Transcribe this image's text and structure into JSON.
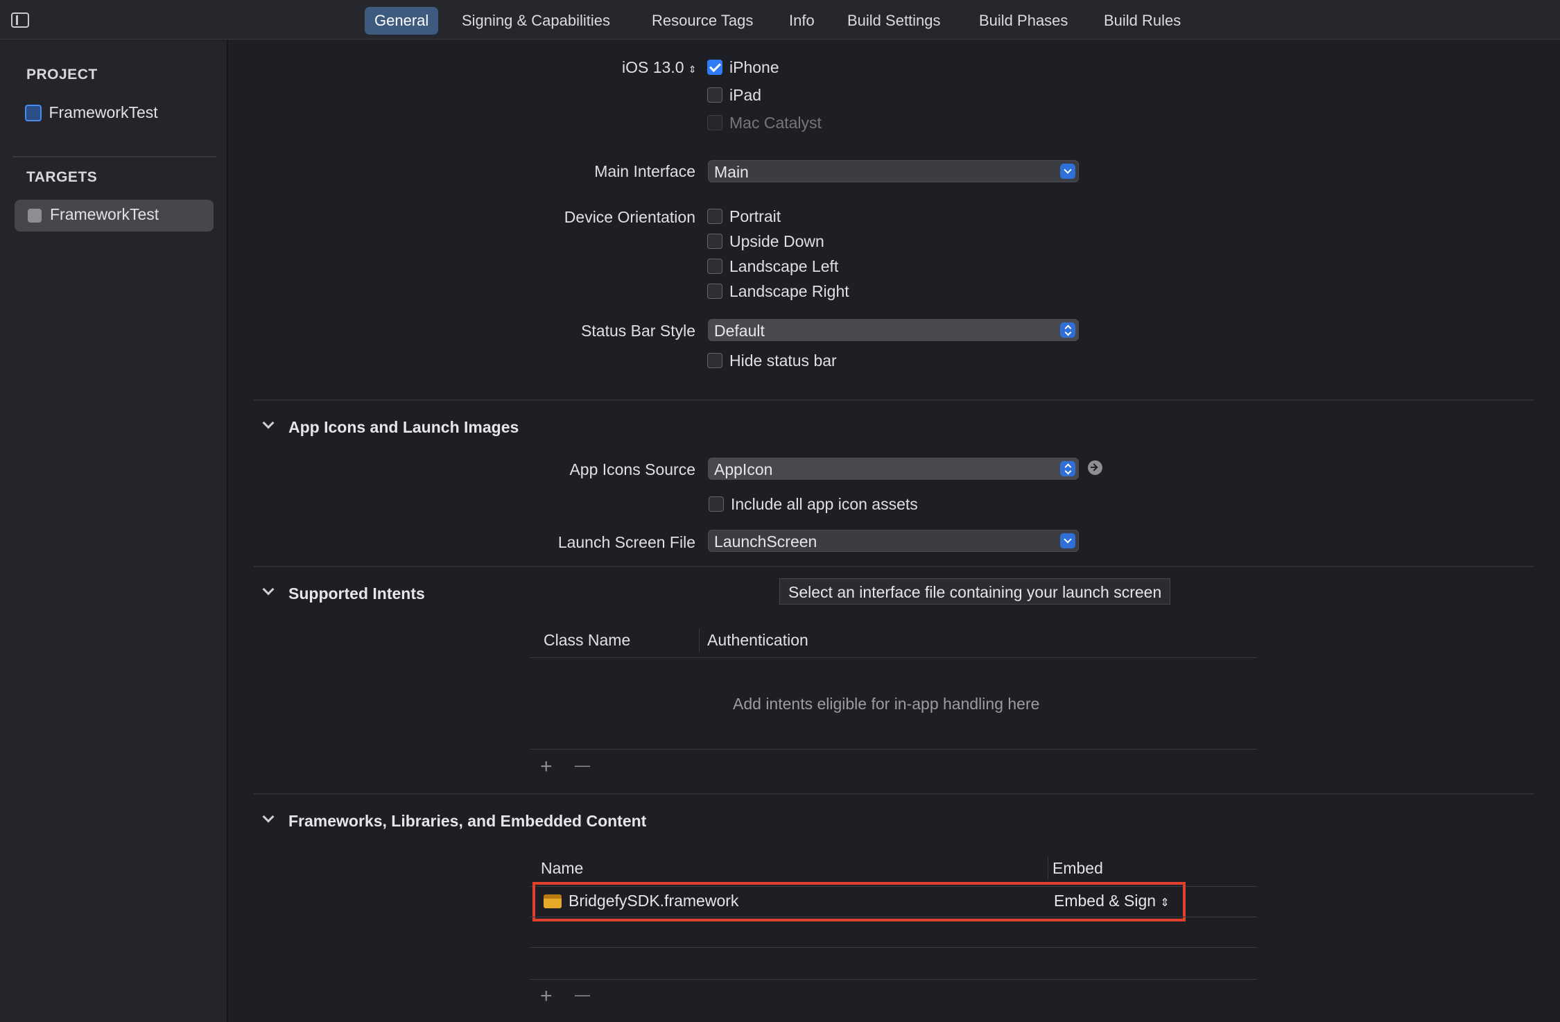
{
  "toolbar": {
    "tabs": [
      {
        "label": "General",
        "active": true
      },
      {
        "label": "Signing & Capabilities",
        "active": false
      },
      {
        "label": "Resource Tags",
        "active": false
      },
      {
        "label": "Info",
        "active": false
      },
      {
        "label": "Build Settings",
        "active": false
      },
      {
        "label": "Build Phases",
        "active": false
      },
      {
        "label": "Build Rules",
        "active": false
      }
    ]
  },
  "sidebar": {
    "project_header": "PROJECT",
    "project_name": "FrameworkTest",
    "targets_header": "TARGETS",
    "target_name": "FrameworkTest"
  },
  "deployment": {
    "ios_version": "iOS 13.0",
    "devices": [
      {
        "label": "iPhone",
        "checked": true,
        "enabled": true
      },
      {
        "label": "iPad",
        "checked": false,
        "enabled": true
      },
      {
        "label": "Mac Catalyst",
        "checked": false,
        "enabled": false
      }
    ],
    "main_interface_label": "Main Interface",
    "main_interface_value": "Main",
    "device_orientation_label": "Device Orientation",
    "orientations": [
      "Portrait",
      "Upside Down",
      "Landscape Left",
      "Landscape Right"
    ],
    "status_bar_style_label": "Status Bar Style",
    "status_bar_style_value": "Default",
    "hide_status_bar": "Hide status bar"
  },
  "app_icons": {
    "title": "App Icons and Launch Images",
    "source_label": "App Icons Source",
    "source_value": "AppIcon",
    "include_all": "Include all app icon assets",
    "launch_label": "Launch Screen File",
    "launch_value": "LaunchScreen",
    "tooltip": "Select an interface file containing your launch screen"
  },
  "intents": {
    "title": "Supported Intents",
    "col_class": "Class Name",
    "col_auth": "Authentication",
    "placeholder": "Add intents eligible for in-app handling here"
  },
  "frameworks": {
    "title": "Frameworks, Libraries, and Embedded Content",
    "col_name": "Name",
    "col_embed": "Embed",
    "rows": [
      {
        "name": "BridgefySDK.framework",
        "embed": "Embed & Sign"
      }
    ]
  },
  "symbols": {
    "plus": "+",
    "minus": "—"
  }
}
